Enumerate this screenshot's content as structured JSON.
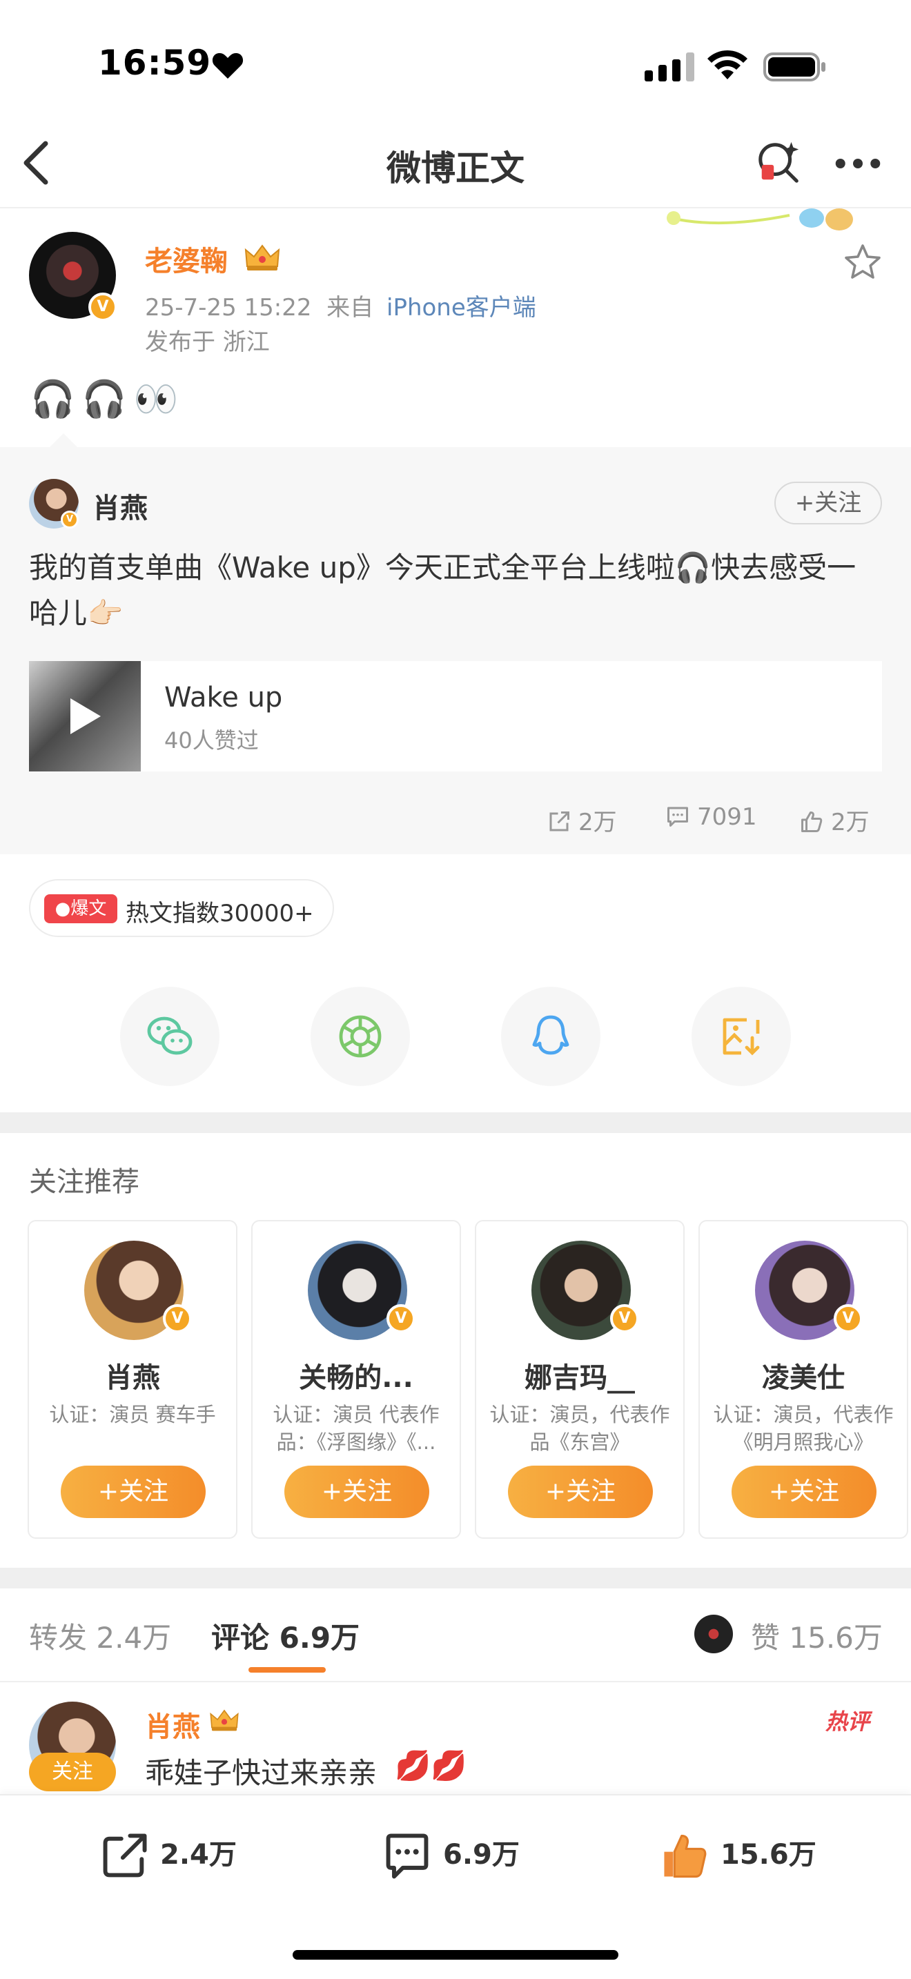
{
  "status_bar": {
    "time": "16:59",
    "icons": [
      "heart-icon",
      "cellular-signal-icon",
      "wifi-icon",
      "battery-icon"
    ]
  },
  "nav": {
    "title": "微博正文",
    "icons": [
      "back-chevron-icon",
      "ai-search-icon",
      "more-dots-icon"
    ]
  },
  "post": {
    "author": "老婆鞠",
    "time": "25-7-25 15:22",
    "source_prefix": "来自",
    "source": "iPhone客户端",
    "location": "发布于 浙江",
    "content_emoji": "🎧🎧👀"
  },
  "retweet": {
    "author": "肖燕",
    "follow_label": "+关注",
    "text": "我的首支单曲《Wake up》今天正式全平台上线啦🎧快去感受一哈儿👉🏻",
    "music": {
      "title": "Wake up",
      "subtitle": "40人赞过"
    },
    "stats": {
      "reposts": "2万",
      "comments": "7091",
      "likes": "2万"
    }
  },
  "hot": {
    "tag": "爆文",
    "text": "热文指数30000+"
  },
  "share": {
    "items": [
      "wechat-icon",
      "moments-icon",
      "qq-icon",
      "save-image-icon"
    ]
  },
  "recommend": {
    "title": "关注推荐",
    "cards": [
      {
        "name": "肖燕",
        "desc": "认证：演员 赛车手",
        "btn": "+关注"
      },
      {
        "name": "关畅的...",
        "desc": "认证：演员 代表作品：《浮图缘》《...",
        "btn": "+关注"
      },
      {
        "name": "娜吉玛__",
        "desc": "认证：演员，代表作品《东宫》",
        "btn": "+关注"
      },
      {
        "name": "凌美仕",
        "desc": "认证：演员，代表作《明月照我心》",
        "btn": "+关注"
      }
    ]
  },
  "tabs": {
    "repost": {
      "label": "转发",
      "count": "2.4万"
    },
    "comment": {
      "label": "评论",
      "count": "6.9万"
    },
    "like": {
      "label": "赞",
      "count": "15.6万"
    }
  },
  "comment": {
    "author": "肖燕",
    "follow_label": "关注",
    "hot_label": "热评",
    "text": "乖娃子快过来亲亲",
    "emoji": "💋💋"
  },
  "bottom_bar": {
    "repost": "2.4万",
    "comment": "6.9万",
    "like": "15.6万"
  },
  "colors": {
    "accent_orange": "#f5802b",
    "link_blue": "#5d87b9",
    "hot_red": "#f0454a",
    "verified_badge": "#f5a623"
  }
}
